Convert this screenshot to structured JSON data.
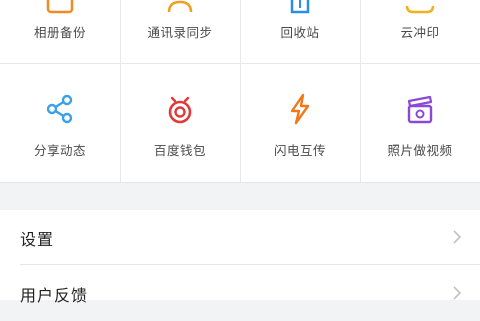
{
  "grid": {
    "row1": [
      {
        "label": "相册备份",
        "icon": "photo-backup-icon",
        "color": "#f08a24"
      },
      {
        "label": "通讯录同步",
        "icon": "contacts-sync-icon",
        "color": "#f0a020"
      },
      {
        "label": "回收站",
        "icon": "recycle-bin-icon",
        "color": "#2a8fe8"
      },
      {
        "label": "云冲印",
        "icon": "cloud-print-icon",
        "color": "#f0b020"
      }
    ],
    "row2": [
      {
        "label": "分享动态",
        "icon": "share-icon",
        "color": "#3aa0e8"
      },
      {
        "label": "百度钱包",
        "icon": "wallet-icon",
        "color": "#e23a3a"
      },
      {
        "label": "闪电互传",
        "icon": "lightning-icon",
        "color": "#f07a1a"
      },
      {
        "label": "照片做视频",
        "icon": "photo-video-icon",
        "color": "#8a4ad8"
      }
    ]
  },
  "menu": {
    "items": [
      {
        "label": "设置"
      },
      {
        "label": "用户反馈"
      }
    ]
  },
  "colors": {
    "background": "#f2f3f5",
    "text": "#222222",
    "chevron": "#c2c2c2"
  }
}
